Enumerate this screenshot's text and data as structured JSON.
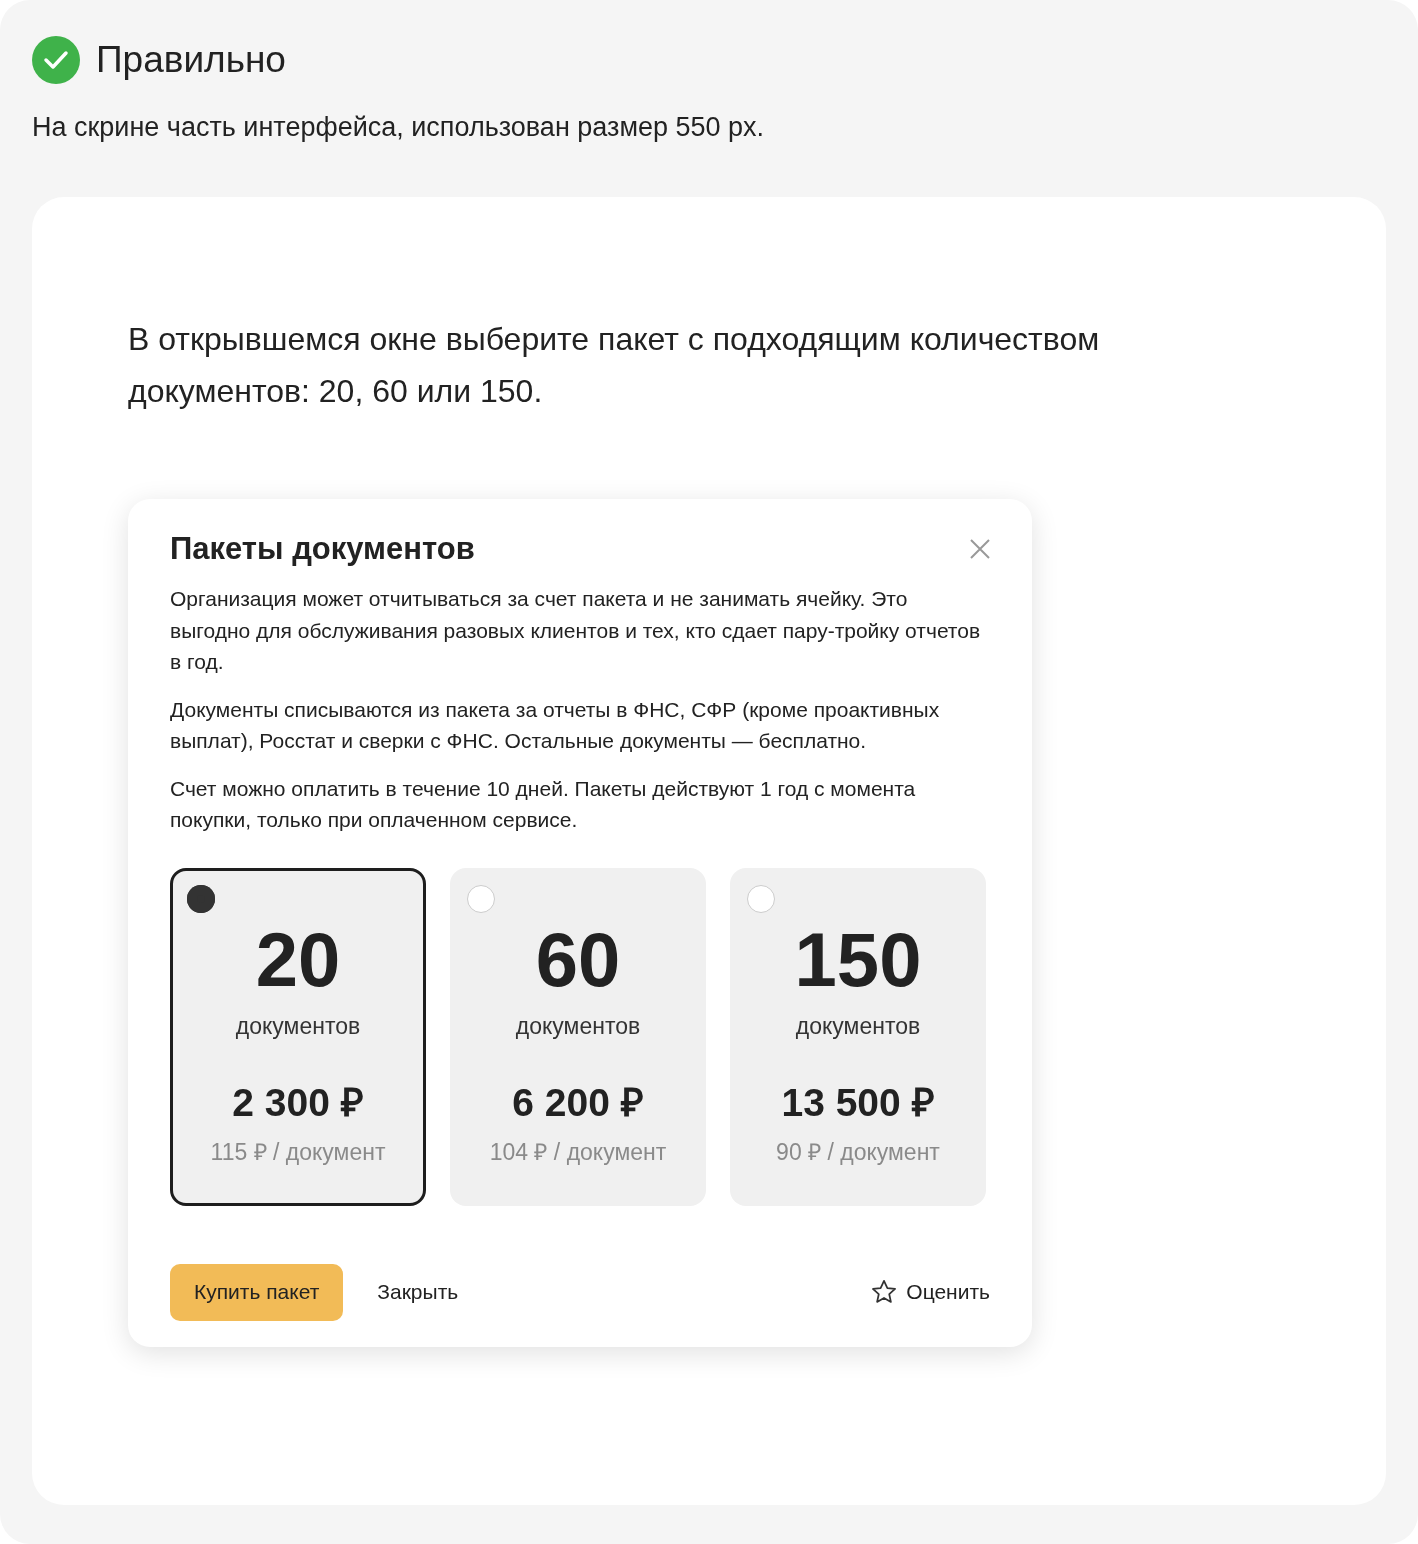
{
  "header": {
    "status": "Правильно",
    "note": "На скрине часть интерфейса, использован размер 550 px."
  },
  "instruction": "В открывшемся окне выберите пакет с подходящим количеством документов: 20, 60 или 150.",
  "dialog": {
    "title": "Пакеты документов",
    "paragraphs": [
      "Организация может отчитываться за счет пакета и не занимать ячейку. Это выгодно для обслуживания разовых клиентов и тех, кто сдает пару-тройку отчетов в год.",
      "Документы списываются из пакета за отчеты в ФНС, СФР (кроме проактивных выплат), Росстат и сверки с ФНС. Остальные документы — бесплатно.",
      "Счет можно оплатить в течение 10 дней. Пакеты действуют 1 год с момента покупки, только при оплаченном сервисе."
    ],
    "packages": [
      {
        "count": "20",
        "unit": "документов",
        "price": "2 300 ₽",
        "per_document": "115 ₽ / документ",
        "selected": true
      },
      {
        "count": "60",
        "unit": "документов",
        "price": "6 200 ₽",
        "per_document": "104 ₽ / документ",
        "selected": false
      },
      {
        "count": "150",
        "unit": "документов",
        "price": "13 500 ₽",
        "per_document": "90 ₽ / документ",
        "selected": false
      }
    ],
    "buy_button": "Купить пакет",
    "close_button": "Закрыть",
    "rate_button": "Оценить"
  }
}
